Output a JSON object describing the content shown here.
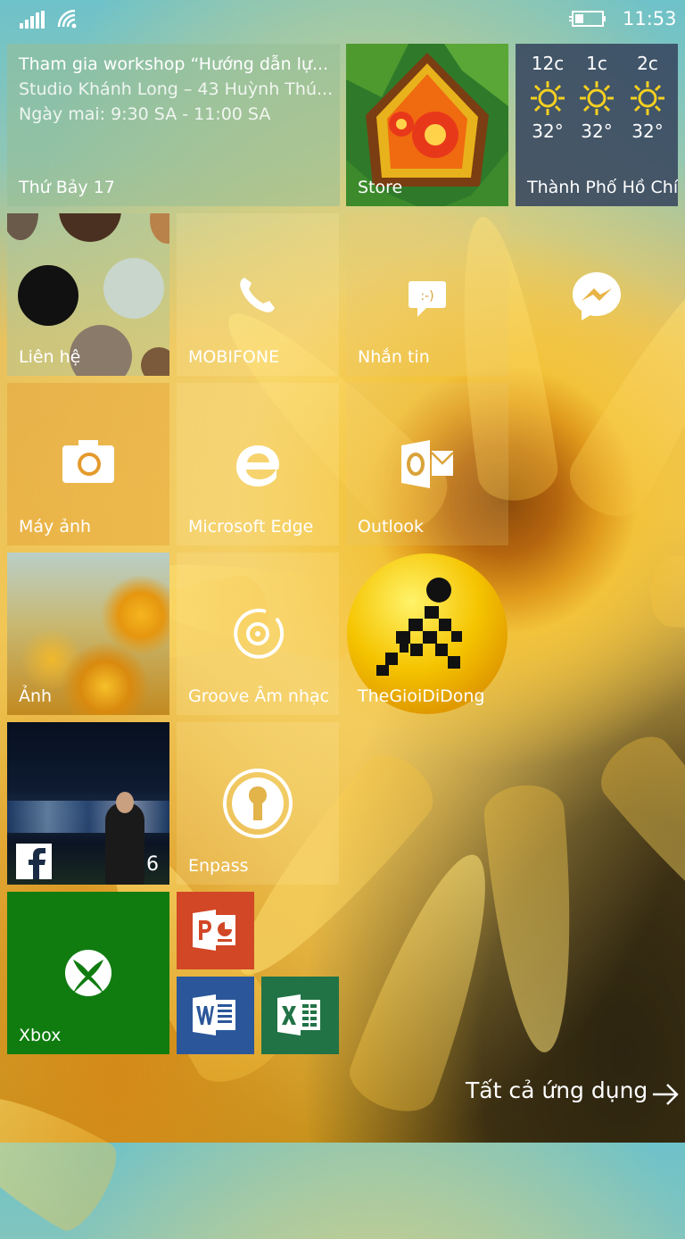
{
  "status": {
    "time": "11:53"
  },
  "tiles": {
    "calendar": {
      "title": "Tham gia workshop “Hướng dẫn lự...",
      "location": "Studio Khánh Long – 43 Huỳnh Thú...",
      "time": "Ngày mai: 9:30 SA - 11:00 SA",
      "date": "Thứ Bảy 17"
    },
    "store": {
      "label": "Store"
    },
    "weather": {
      "label": "Thành Phố Hồ Chí",
      "days": [
        {
          "hour": "12c",
          "temp": "32°"
        },
        {
          "hour": "1c",
          "temp": "32°"
        },
        {
          "hour": "2c",
          "temp": "32°"
        }
      ]
    },
    "contacts": {
      "label": "Liên hệ"
    },
    "phone": {
      "label": "MOBIFONE"
    },
    "messaging": {
      "label": "Nhắn tin"
    },
    "camera": {
      "label": "Máy ảnh"
    },
    "edge": {
      "label": "Microsoft Edge"
    },
    "outlook": {
      "label": "Outlook"
    },
    "photos": {
      "label": "Ảnh"
    },
    "groove": {
      "label": "Groove Âm nhạc"
    },
    "thegioididong": {
      "label": "TheGioiDiDong"
    },
    "facebook": {
      "count": "6"
    },
    "enpass": {
      "label": "Enpass"
    },
    "xbox": {
      "label": "Xbox"
    }
  },
  "all_apps": {
    "label": "Tất cả ứng dụng"
  },
  "colors": {
    "xbox": "#107c10",
    "powerpoint": "#d24726",
    "word": "#2b579a",
    "excel": "#217346",
    "tgdd_yellow": "#f5c400"
  }
}
